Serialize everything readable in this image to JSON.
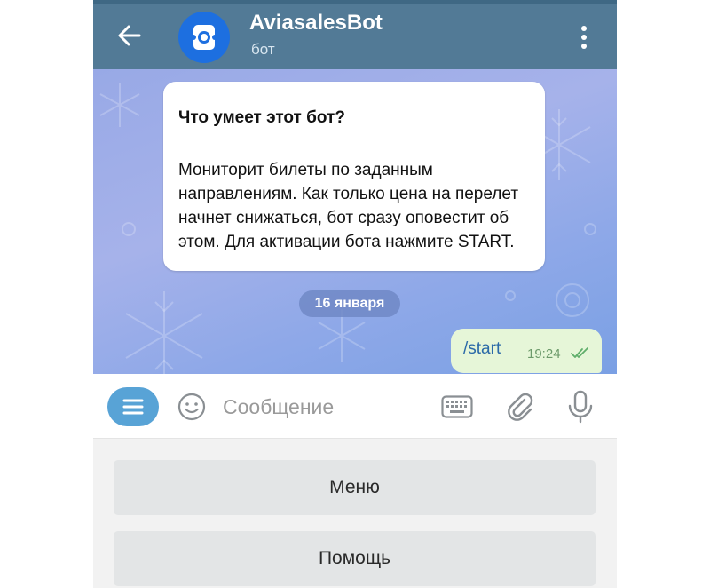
{
  "header": {
    "title": "AviasalesBot",
    "subtitle": "бот"
  },
  "messages": {
    "bot_intro_title": "Что умеет этот бот?",
    "bot_intro_text": "Мониторит билеты по заданным направлениям. Как только цена на перелет начнет снижаться, бот сразу оповестит об этом. Для активации бота нажмите  START.",
    "date": "16 января",
    "user_command": "/start",
    "user_time": "19:24"
  },
  "input": {
    "placeholder": "Сообщение",
    "value": ""
  },
  "keyboard": {
    "button_1": "Меню",
    "button_2": "Помощь"
  },
  "colors": {
    "header": "#527a96",
    "accent": "#58a3d6",
    "outgoing_bubble": "#e6f6d8",
    "avatar": "#1d6fe0"
  }
}
